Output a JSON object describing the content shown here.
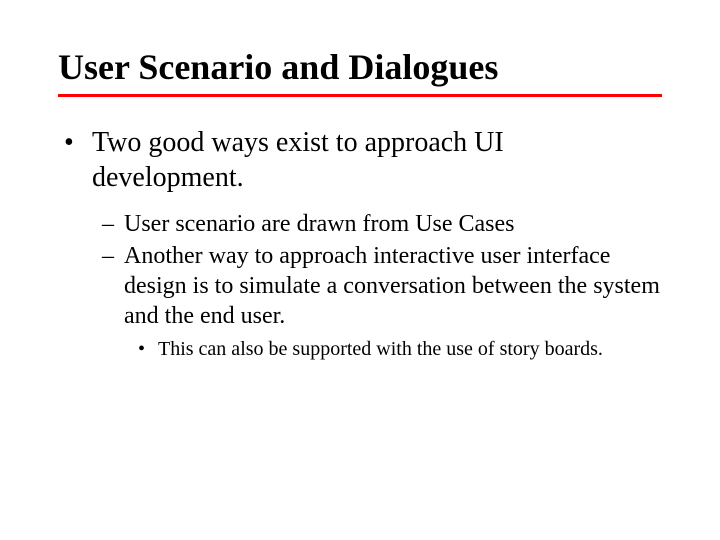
{
  "title": "User Scenario and Dialogues",
  "bullets": {
    "l1_1": "Two good ways exist to approach UI development.",
    "l2_1": "User scenario are drawn from Use Cases",
    "l2_2": "Another way to approach interactive user interface design is to simulate a conversation between the system and the end user.",
    "l3_1": "This can also be supported with the use of story boards."
  },
  "glyphs": {
    "bullet": "•",
    "dash": "–"
  },
  "colors": {
    "rule": "#ff0000",
    "text": "#000000",
    "bg": "#ffffff"
  }
}
